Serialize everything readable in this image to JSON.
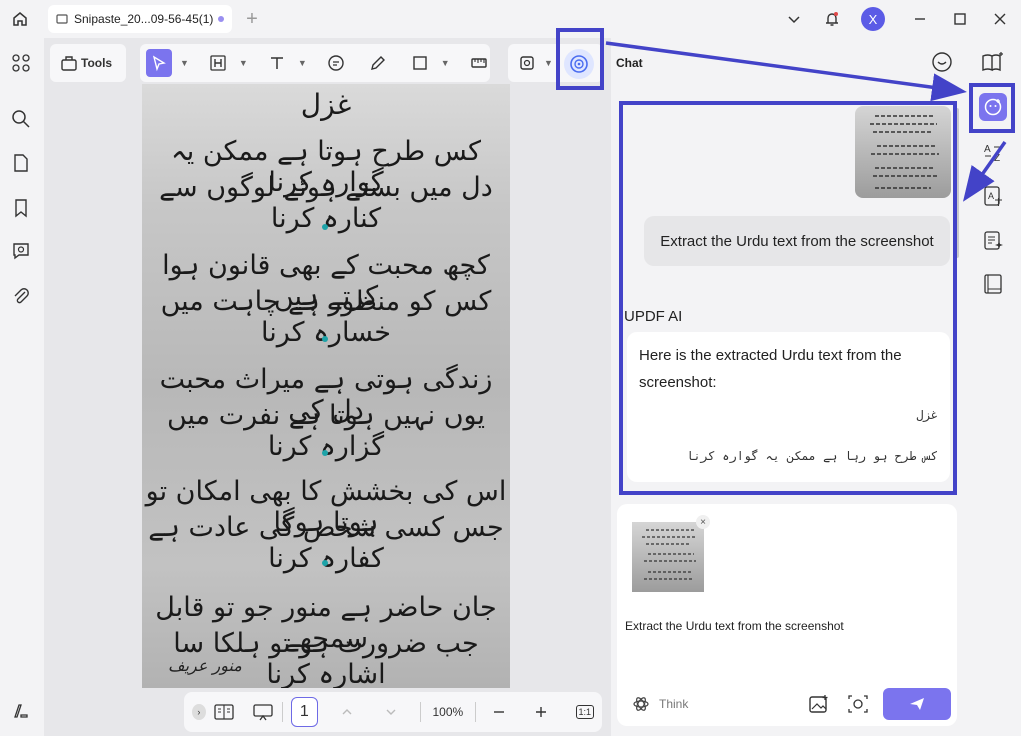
{
  "window": {
    "tab_title": "Snipaste_20...09-56-45(1)",
    "user_initial": "X"
  },
  "toolbar": {
    "tools_label": "Tools"
  },
  "document": {
    "poem_title": "غزل",
    "lines": [
      "کس طرح ہوتا ہے ممکن یہ گوارہ کرنا",
      "دل میں بستے ہوئے لوگوں سے کنارہ کرنا",
      "کچھ محبت کے بھی قانون ہوا کرتے ہیں",
      "کس کو منظور ہے چاہت میں خسارہ کرنا",
      "زندگی ہوتی ہے میراث محبت دل کی",
      "یوں نہیں ہوتا ہے نفرت میں گزارہ کرنا",
      "اس کی بخشش کا بھی امکان تو ہوتا ہوگا",
      "جس کسی شخص کی عادت ہے کفارہ کرنا",
      "جان حاضر ہے منور جو تو قابل سمجھے",
      "جب ضرورت ہو تو ہلکا سا اشارہ کرنا"
    ],
    "signature": "منور عریف"
  },
  "bottom_bar": {
    "page_number": "1",
    "zoom": "100%",
    "fit_label": "1:1"
  },
  "chat": {
    "title": "Chat",
    "user_message": "Extract the Urdu text from the screenshot",
    "ai_name": "UPDF AI",
    "ai_response": "Here is the extracted Urdu text from the screenshot:",
    "ai_urdu_title": "غزل",
    "ai_urdu_line": "کس طرح ہو رہا ہے ممکن یہ گوارہ کرنا",
    "input_text": "Extract the Urdu text from the screenshot",
    "think_label": "Think"
  },
  "colors": {
    "accent": "#7b74ee",
    "highlight": "#4343c8"
  }
}
